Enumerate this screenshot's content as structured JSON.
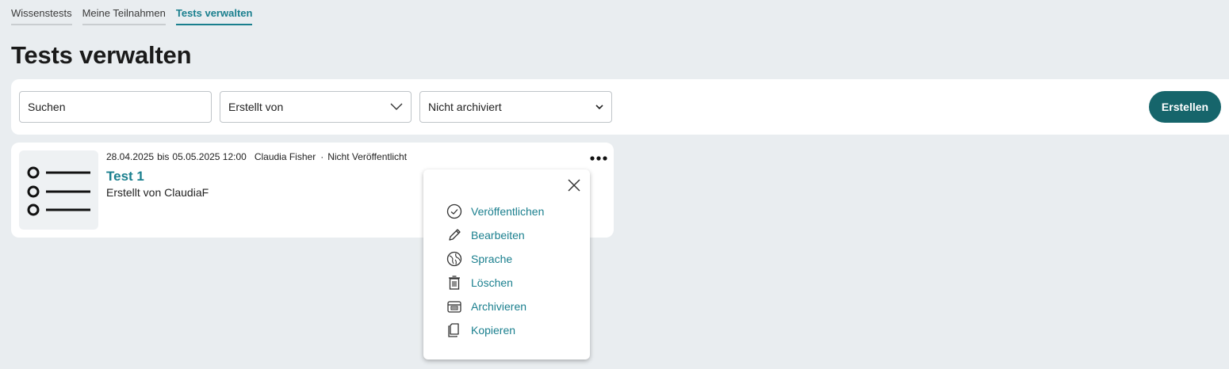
{
  "tabs": [
    {
      "label": "Wissenstests",
      "active": false
    },
    {
      "label": "Meine Teilnahmen",
      "active": false
    },
    {
      "label": "Tests verwalten",
      "active": true
    }
  ],
  "page_title": "Tests verwalten",
  "filters": {
    "search_placeholder": "Suchen",
    "created_by_label": "Erstellt von",
    "archive_selected": "Nicht archiviert",
    "create_button_label": "Erstellen"
  },
  "test_card": {
    "start_date": "28.04.2025",
    "until": "bis",
    "end_date": "05.05.2025 12:00",
    "author": "Claudia Fisher",
    "separator": "·",
    "status": "Nicht Veröffentlicht",
    "title": "Test 1",
    "created_by": "Erstellt von ClaudiaF"
  },
  "context_menu": {
    "items": [
      {
        "label": "Veröffentlichen",
        "icon": "check-circle-icon"
      },
      {
        "label": "Bearbeiten",
        "icon": "pencil-icon"
      },
      {
        "label": "Sprache",
        "icon": "globe-icon"
      },
      {
        "label": "Löschen",
        "icon": "trash-icon"
      },
      {
        "label": "Archivieren",
        "icon": "archive-icon"
      },
      {
        "label": "Kopieren",
        "icon": "copy-icon"
      }
    ]
  },
  "colors": {
    "accent": "#1a7f8e",
    "button": "#16656b",
    "background": "#e9edf0"
  }
}
